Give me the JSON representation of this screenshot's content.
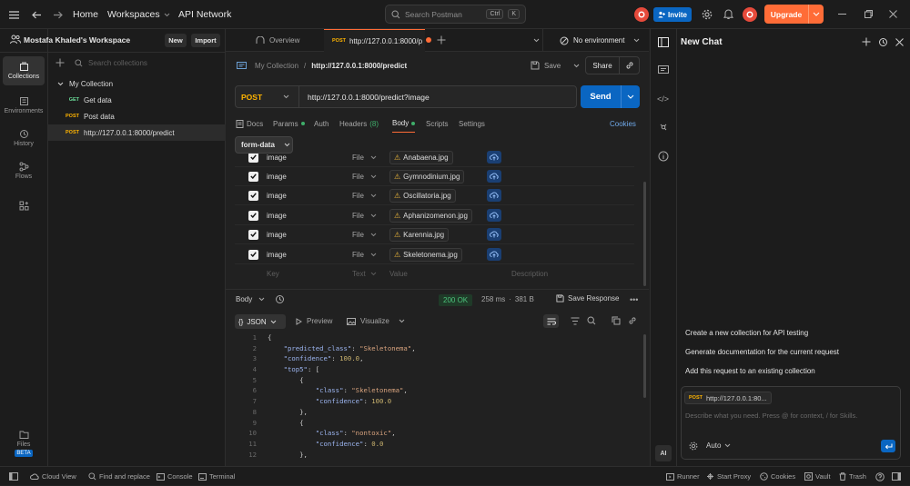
{
  "topbar": {
    "home": "Home",
    "workspaces": "Workspaces",
    "api_network": "API Network",
    "search_placeholder": "Search Postman",
    "kbd_ctrl": "Ctrl",
    "kbd_k": "K",
    "invite": "Invite",
    "upgrade": "Upgrade"
  },
  "workspace": {
    "name": "Mostafa Khaled's Workspace",
    "new_btn": "New",
    "import_btn": "Import"
  },
  "leftrail": {
    "items": [
      {
        "label": "Collections",
        "icon": "collections-icon"
      },
      {
        "label": "Environments",
        "icon": "environments-icon"
      },
      {
        "label": "History",
        "icon": "history-icon"
      },
      {
        "label": "Flows",
        "icon": "flows-icon"
      },
      {
        "label": "",
        "icon": "apps-icon"
      }
    ],
    "files": "Files",
    "beta": "BETA"
  },
  "sidebar": {
    "search_placeholder": "Search collections",
    "collection": "My Collection",
    "requests": [
      {
        "method": "GET",
        "name": "Get data"
      },
      {
        "method": "POST",
        "name": "Post data"
      },
      {
        "method": "POST",
        "name": "http://127.0.0.1:8000/predict"
      }
    ]
  },
  "tabs": {
    "overview": "Overview",
    "active_method": "POST",
    "active_title": "http://127.0.0.1:8000/p",
    "environment": "No environment"
  },
  "request": {
    "breadcrumb_parent": "My Collection",
    "breadcrumb_sep": "/",
    "breadcrumb_current": "http://127.0.0.1:8000/predict",
    "save": "Save",
    "share": "Share",
    "method": "POST",
    "url": "http://127.0.0.1:8000/predict?image",
    "send": "Send",
    "subtabs": [
      "Docs",
      "Params",
      "Auth",
      "Headers",
      "Body",
      "Scripts",
      "Settings"
    ],
    "headers_count": "(8)",
    "cookies": "Cookies",
    "body_type": "form-data"
  },
  "formdata": {
    "rows": [
      {
        "key": "image",
        "type": "File",
        "file": "Anabaena.jpg"
      },
      {
        "key": "image",
        "type": "File",
        "file": "Gymnodinium.jpg"
      },
      {
        "key": "image",
        "type": "File",
        "file": "Oscillatoria.jpg"
      },
      {
        "key": "image",
        "type": "File",
        "file": "Aphanizomenon.jpg"
      },
      {
        "key": "image",
        "type": "File",
        "file": "Karennia.jpg"
      },
      {
        "key": "image",
        "type": "File",
        "file": "Skeletonema.jpg"
      }
    ],
    "placeholder_key": "Key",
    "placeholder_type": "Text",
    "placeholder_value": "Value",
    "placeholder_desc": "Description"
  },
  "response": {
    "label": "Body",
    "status": "200 OK",
    "time": "258 ms",
    "size": "381 B",
    "save_response": "Save Response",
    "format": "JSON",
    "preview": "Preview",
    "visualize": "Visualize",
    "lines": [
      {
        "n": "1",
        "text": "{"
      },
      {
        "n": "2",
        "text": "    \"predicted_class\": \"Skeletonema\","
      },
      {
        "n": "3",
        "text": "    \"confidence\": 100.0,"
      },
      {
        "n": "4",
        "text": "    \"top5\": ["
      },
      {
        "n": "5",
        "text": "        {"
      },
      {
        "n": "6",
        "text": "            \"class\": \"Skeletonema\","
      },
      {
        "n": "7",
        "text": "            \"confidence\": 100.0"
      },
      {
        "n": "8",
        "text": "        },"
      },
      {
        "n": "9",
        "text": "        {"
      },
      {
        "n": "10",
        "text": "            \"class\": \"nontoxic\","
      },
      {
        "n": "11",
        "text": "            \"confidence\": 0.0"
      },
      {
        "n": "12",
        "text": "        },"
      }
    ]
  },
  "chat": {
    "title": "New Chat",
    "suggestions": [
      "Create a new collection for API testing",
      "Generate documentation for the current request",
      "Add this request to an existing collection"
    ],
    "context_method": "POST",
    "context_url": "http://127.0.0.1:80...",
    "input_placeholder": "Describe what you need. Press @ for context, / for Skills.",
    "mode": "Auto"
  },
  "statusbar": {
    "cloud_view": "Cloud View",
    "find_replace": "Find and replace",
    "console": "Console",
    "terminal": "Terminal",
    "runner": "Runner",
    "start_proxy": "Start Proxy",
    "cookies": "Cookies",
    "vault": "Vault",
    "trash": "Trash"
  },
  "colors": {
    "accent": "#ff6c37",
    "primary": "#0a66c2",
    "post": "#ffb400",
    "get": "#6bdd9a",
    "status_ok": "#3fae6a"
  }
}
